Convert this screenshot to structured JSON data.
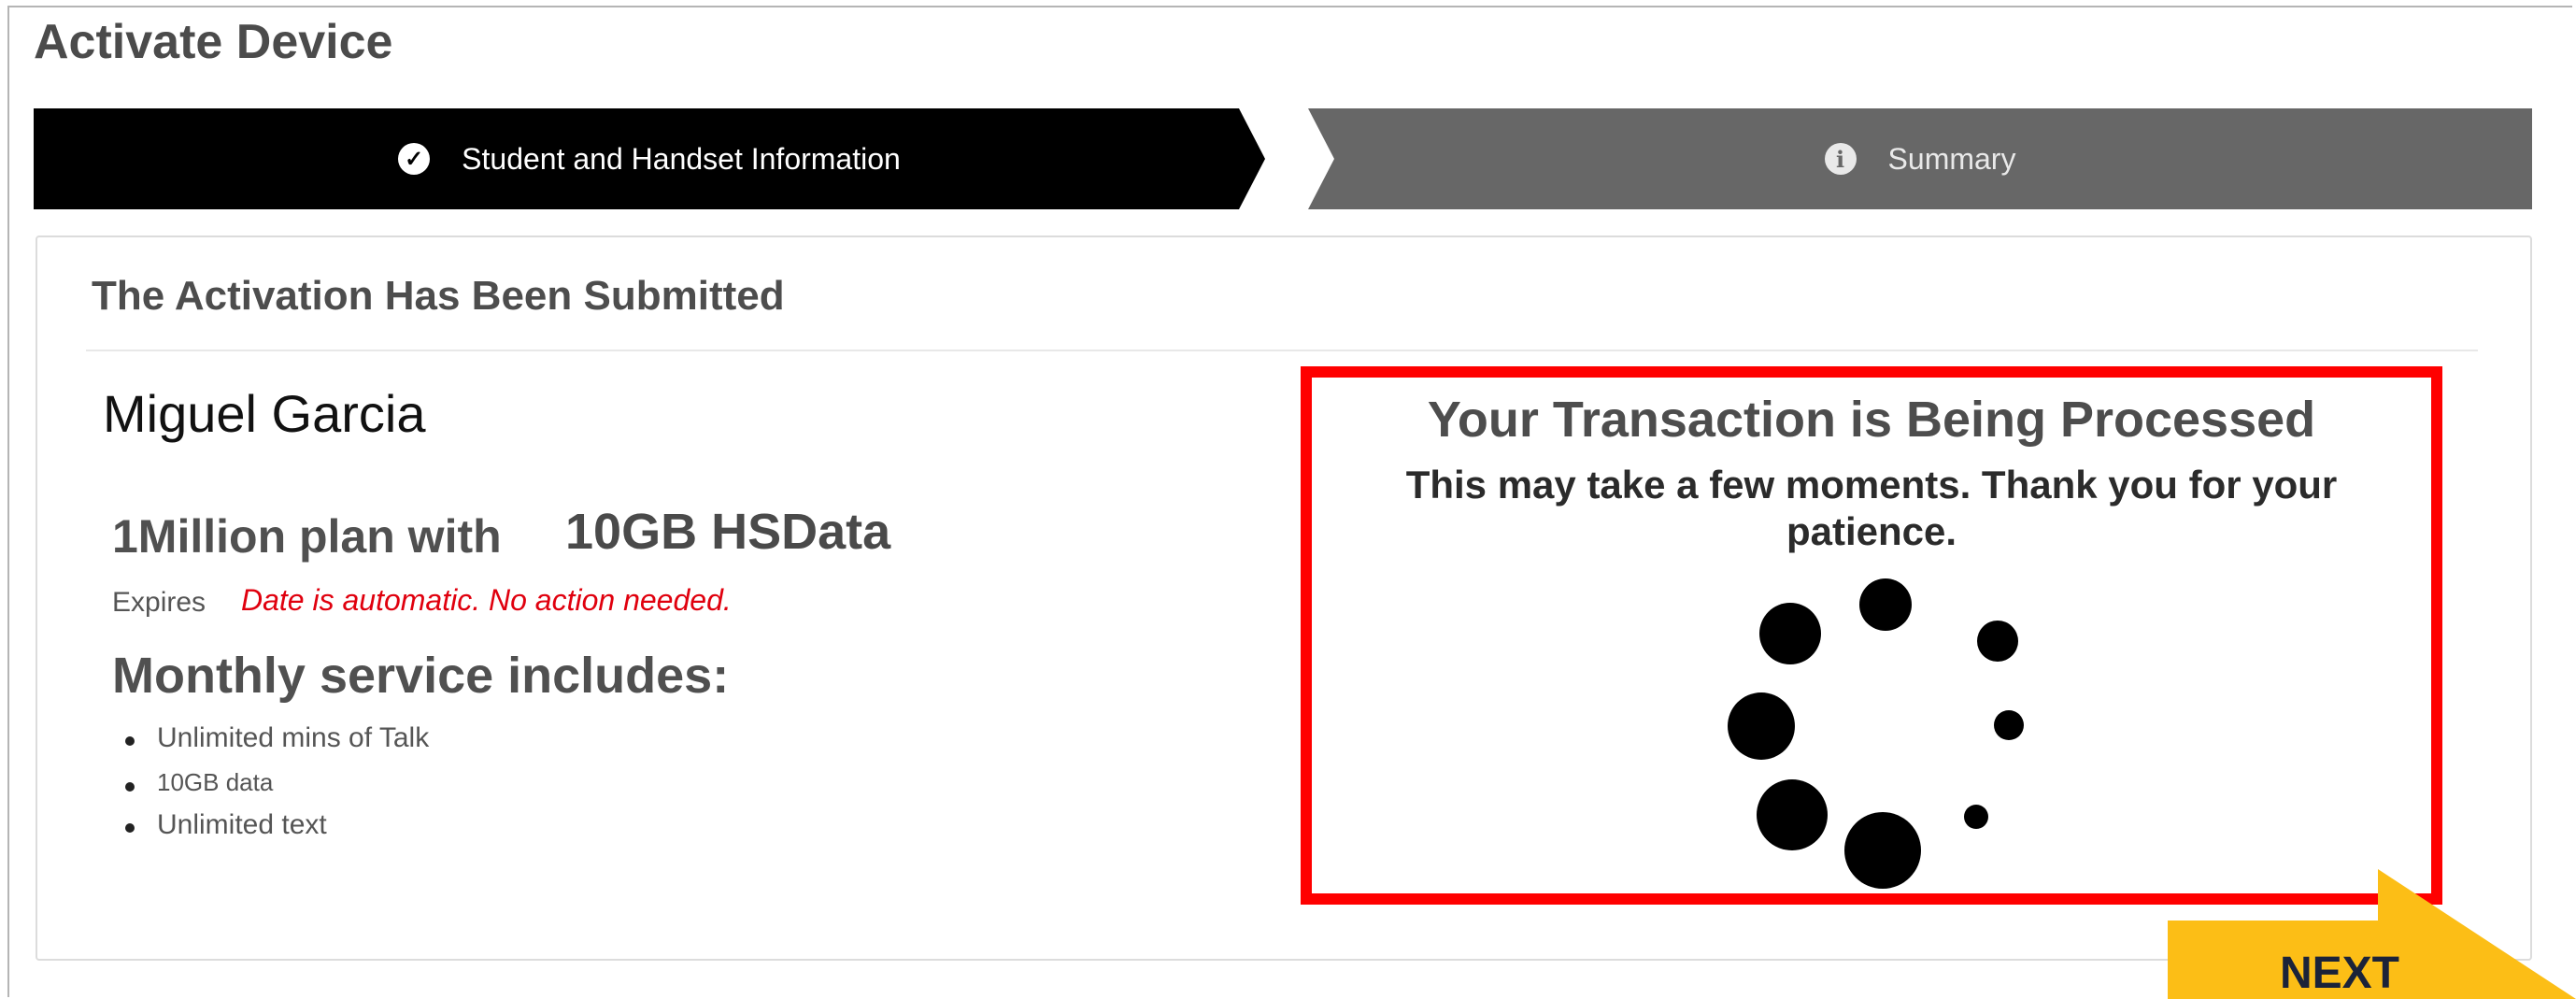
{
  "page": {
    "title": "Activate Device"
  },
  "steps": [
    {
      "label": "Student and Handset Information",
      "icon": "check-circle-icon",
      "active": true
    },
    {
      "label": "Summary",
      "icon": "info-circle-icon",
      "active": false
    }
  ],
  "panel": {
    "title": "The Activation Has Been Submitted",
    "customer_name": "Miguel Garcia",
    "plan": "1Million plan with",
    "plan_data": "10GB HSData",
    "expires_label": "Expires",
    "expires_note": "Date is automatic. No action needed.",
    "includes_title": "Monthly service includes:",
    "features": [
      "Unlimited mins of Talk",
      "10GB data",
      "Unlimited text"
    ]
  },
  "processing": {
    "title": "Your Transaction is Being Processed",
    "message": "This may take a few moments. Thank you for your patience.",
    "icon": "loading-spinner-icon"
  },
  "next_button": {
    "label": "NEXT"
  },
  "colors": {
    "highlight": "#ff0000",
    "next_button": "#fcbe16",
    "note": "#e0000e",
    "active_step": "#000000",
    "inactive_step": "#676767"
  }
}
